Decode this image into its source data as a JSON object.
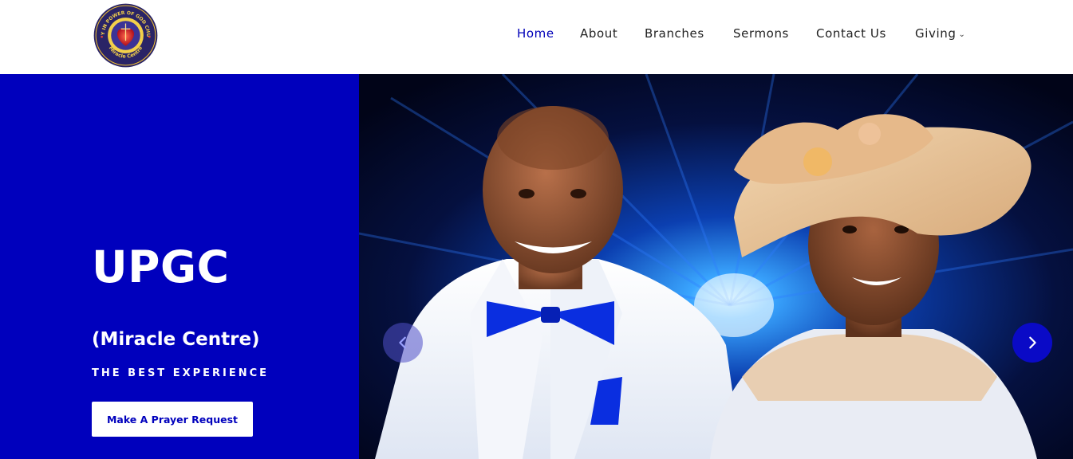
{
  "brand": {
    "logo_ring_text": "UNITY IN POWER OF GOD CHURCH",
    "logo_bottom_text": "Miracle Centre"
  },
  "nav": {
    "items": [
      {
        "label": "Home"
      },
      {
        "label": "About"
      },
      {
        "label": "Branches"
      },
      {
        "label": "Sermons"
      },
      {
        "label": "Contact Us"
      },
      {
        "label": "Giving"
      }
    ],
    "active": "Home"
  },
  "hero": {
    "title": "UPGC",
    "subtitle": "(Miracle Centre)",
    "tagline": "THE BEST EXPERIENCE",
    "cta_label": "Make A Prayer Request"
  },
  "slider": {
    "prev_icon": "chevron-left-icon",
    "next_icon": "chevron-right-icon"
  },
  "colors": {
    "primary_blue": "#0000bd",
    "nav_active": "#0000b8",
    "nav_text": "#222222",
    "white": "#ffffff"
  }
}
